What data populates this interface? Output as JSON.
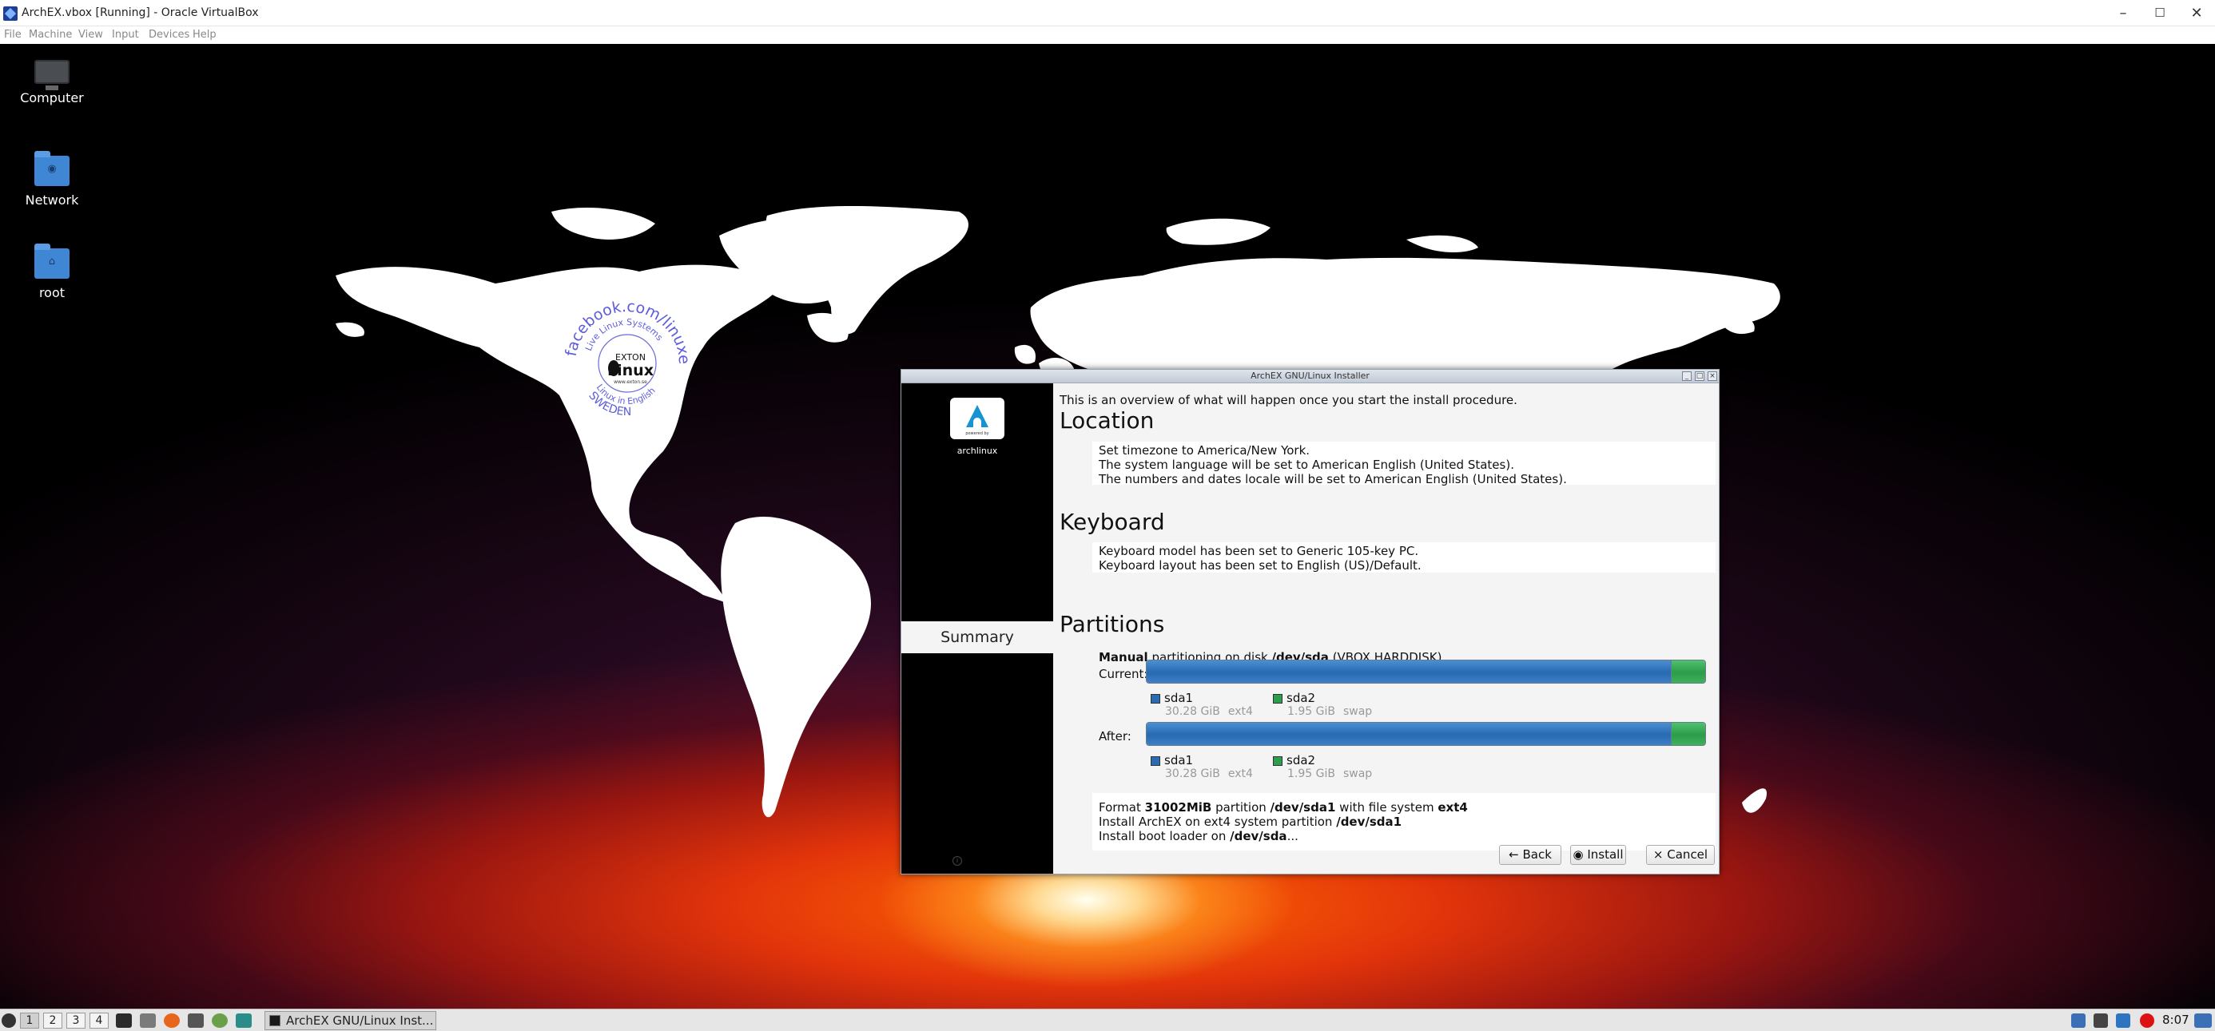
{
  "host": {
    "title": "ArchEX.vbox [Running] - Oracle VirtualBox",
    "menu": [
      "File",
      "Machine",
      "View",
      "Input",
      "Devices",
      "Help"
    ]
  },
  "desktop": {
    "icons": [
      {
        "label": "Computer",
        "icon": "computer-icon"
      },
      {
        "label": "Network",
        "icon": "network-folder-icon"
      },
      {
        "label": "root",
        "icon": "home-folder-icon"
      }
    ],
    "stamp": {
      "outer_text": "facebook.com/linuxexton",
      "inner_text": "Live Linux Systems",
      "center_top": "EXTON",
      "center_main": "Linux",
      "center_small": "www.exton.se",
      "bottom_text": "SWEDEN",
      "bottom_inner": "Linux in English"
    }
  },
  "installer": {
    "title": "ArchEX GNU/Linux Installer",
    "logo_caption": "powered by",
    "logo_text": "archlinux",
    "current_step": "Summary",
    "intro": "This is an overview of what will happen once you start the install procedure.",
    "location": {
      "title": "Location",
      "lines": [
        "Set timezone to America/New York.",
        "The system language will be set to American English (United States).",
        "The numbers and dates locale will be set to American English (United States)."
      ]
    },
    "keyboard": {
      "title": "Keyboard",
      "lines": [
        "Keyboard model has been set to Generic 105-key PC.",
        "Keyboard layout has been set to English (US)/Default."
      ]
    },
    "partitions": {
      "title": "Partitions",
      "mode": "Manual",
      "text1": " partitioning on disk ",
      "disk": "/dev/sda",
      "disk_label": " (VBOX HARDDISK)",
      "current_label": "Current:",
      "after_label": "After:",
      "segments": [
        {
          "name": "sda1",
          "size": "30.28 GiB",
          "fs": "ext4",
          "color": "#2a6cb4",
          "fraction": 0.939
        },
        {
          "name": "sda2",
          "size": "1.95 GiB",
          "fs": "swap",
          "color": "#2f9e4c",
          "fraction": 0.061
        }
      ],
      "jobs": {
        "l1a": "Format ",
        "l1b": "31002MiB",
        "l1c": " partition ",
        "l1d": "/dev/sda1",
        "l1e": " with file system ",
        "l1f": "ext4",
        "l2a": "Install ArchEX on ext4 system partition ",
        "l2b": "/dev/sda1",
        "l3a": "Install boot loader on ",
        "l3b": "/dev/sda",
        "l3c": "..."
      }
    },
    "buttons": {
      "back": "Back",
      "install": "Install",
      "cancel": "Cancel"
    }
  },
  "taskbar": {
    "workspaces": [
      "1",
      "2",
      "3",
      "4"
    ],
    "task": "ArchEX GNU/Linux Inst...",
    "clock": "8:07"
  }
}
